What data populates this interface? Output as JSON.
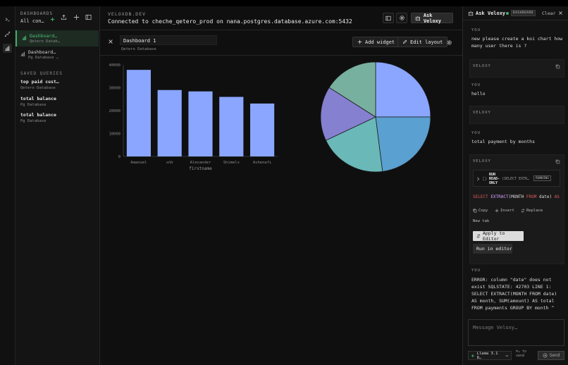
{
  "rail": {
    "icons": [
      "terminal-icon",
      "graph-icon",
      "chart-icon"
    ]
  },
  "sidebar": {
    "title": "DASHBOARDS",
    "connection_label": "All con…",
    "dashboards": [
      {
        "name": "Dashboard…",
        "source": "Qetero Datab…"
      },
      {
        "name": "Dashboard…",
        "source": "Pg Database …"
      }
    ],
    "saved_queries_title": "SAVED QUERIES",
    "saved_queries": [
      {
        "name": "top paid cust…",
        "source": "Qetero Database"
      },
      {
        "name": "total balance",
        "source": "Pg Database"
      },
      {
        "name": "total balance",
        "source": "Pg Database"
      }
    ]
  },
  "header": {
    "brand": "VELOXDB.DEV",
    "connection": "Connected to cheche_qetero_prod on nana.postgres.database.azure.com:5432",
    "ask_label": "Ask Veloxy"
  },
  "dashboard": {
    "name": "Dashboard 1",
    "source": "Qetero Database",
    "add_widget_label": "Add widget",
    "edit_layout_label": "Edit layout"
  },
  "chart_data": [
    {
      "type": "bar",
      "categories": [
        "Amanuel",
        "አባስ",
        "Alexander",
        "Shimels",
        "Ashenafi"
      ],
      "values": [
        37800,
        29000,
        28400,
        26000,
        23100
      ],
      "xlabel": "firstname",
      "ylabel": "",
      "ylim": [
        0,
        40000
      ],
      "yticks": [
        0,
        10000,
        20000,
        30000,
        40000
      ],
      "color": "#8aa6ff"
    },
    {
      "type": "pie",
      "values": [
        25,
        23,
        20,
        16,
        16
      ],
      "colors": [
        "#8aa6ff",
        "#5aa0d0",
        "#6ab8b8",
        "#8680d0",
        "#78b0a0"
      ]
    }
  ],
  "chat": {
    "title": "Ask Veloxy",
    "badge": "DASHBOARD",
    "clear_label": "Clear",
    "messages": [
      {
        "role": "YOU",
        "text": "new please create a koi chart how many user there is ?"
      },
      {
        "role": "VELOXY",
        "text": ""
      },
      {
        "role": "YOU",
        "text": "hello"
      },
      {
        "role": "VELOXY",
        "text": ""
      },
      {
        "role": "YOU",
        "text": "total payment by months"
      },
      {
        "role": "VELOXY",
        "text": ""
      },
      {
        "role": "YOU",
        "text": "ERROR: column \"date\" does not exist SQLSTATE: 42703 LINE 1: SELECT EXTRACT(MONTH FROM date) AS month, SUM(amount) AS total FROM payments GROUP BY month ^"
      }
    ],
    "tool": {
      "run_label": "RUN READ-ONLY",
      "run_preview": "(SELECT EXTR…",
      "status": "RUNNING",
      "sql_keyword1": "SELECT",
      "sql_fn": "EXTRACT",
      "sql_rest1": "(MONTH",
      "sql_keyword2": "FROM",
      "sql_rest2": "date)",
      "sql_keyword3": "AS",
      "copy_label": "Copy",
      "insert_label": "Insert",
      "replace_label": "Replace",
      "new_tab_label": "New tab",
      "apply_label": "Apply to Editor",
      "run_editor_label": "Run in editor"
    },
    "input_placeholder": "Message Veloxy…",
    "model": "Llama 3.1 8…",
    "hint_line1": "⌘↵ to",
    "hint_line2": "send",
    "send_label": "Send"
  },
  "colors": {
    "accent": "#3fae6a",
    "bar": "#8aa6ff"
  }
}
